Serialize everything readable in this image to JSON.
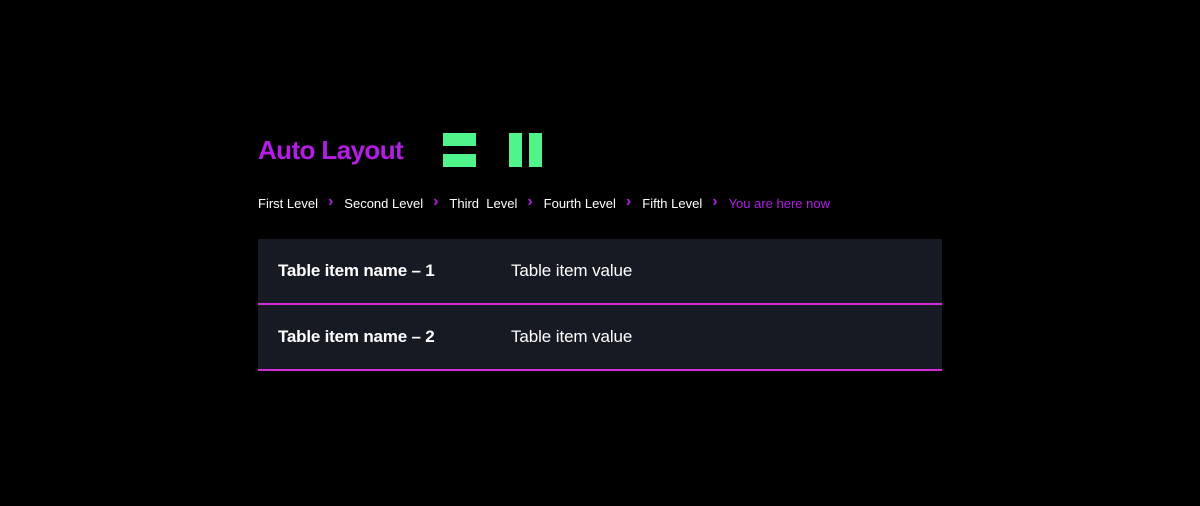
{
  "header": {
    "title": "Auto Layout"
  },
  "icons": {
    "vertical_stack": "vertical-stack-icon",
    "horizontal_stack": "horizontal-stack-icon"
  },
  "breadcrumb": {
    "items": [
      "First Level",
      "Second Level",
      "Third  Level",
      "Fourth Level",
      "Fifth Level"
    ],
    "current": "You are here now",
    "separator": "›"
  },
  "table": {
    "rows": [
      {
        "name": "Table item name – 1",
        "value": "Table item value"
      },
      {
        "name": "Table item name – 2",
        "value": "Table item value"
      }
    ]
  },
  "colors": {
    "background": "#000000",
    "accent_purple": "#b41de6",
    "accent_green": "#4ff58a",
    "row_background": "#161a22",
    "row_divider": "#d42ad8"
  }
}
